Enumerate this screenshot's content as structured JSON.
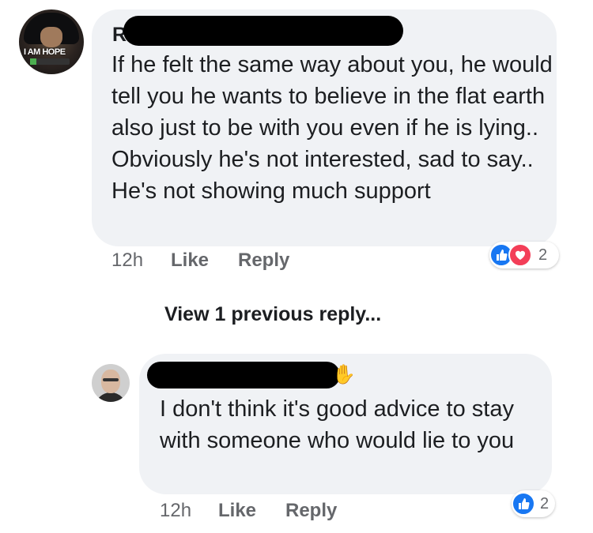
{
  "colors": {
    "bubble_bg": "#f0f2f5",
    "text_primary": "#1c1e21",
    "text_secondary": "#65676b",
    "like_blue": "#1877f2",
    "love_red": "#f33e58"
  },
  "comment1": {
    "author_visible": "R",
    "avatar_text": "I AM HOPE",
    "text": "If he felt the same way about you, he would tell you he wants to believe in the flat earth also just to be with you even if he is lying.. Obviously he's not interested, sad to say.. He's not showing much support",
    "time": "12h",
    "like_label": "Like",
    "reply_label": "Reply",
    "reaction_icons": [
      "like-icon",
      "love-icon"
    ],
    "reaction_count": "2"
  },
  "view_previous": "View 1 previous reply...",
  "comment2": {
    "author_icon": "waving-hand-icon",
    "text": "I don't think it's good advice to stay with someone who would lie to you",
    "time": "12h",
    "like_label": "Like",
    "reply_label": "Reply",
    "reaction_icons": [
      "like-icon"
    ],
    "reaction_count": "2"
  }
}
